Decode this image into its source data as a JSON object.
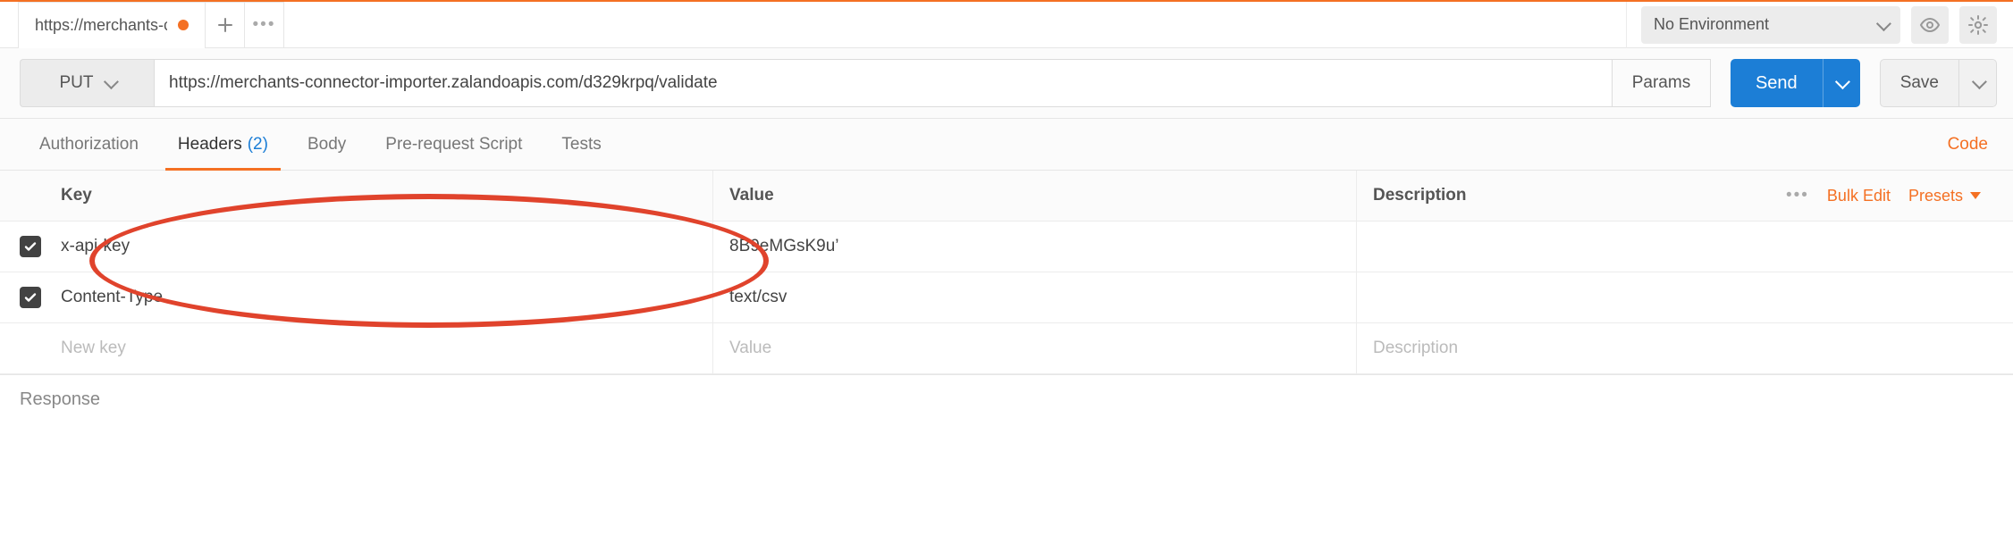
{
  "tab": {
    "label": "https://merchants-con"
  },
  "env": {
    "label": "No Environment"
  },
  "request": {
    "method": "PUT",
    "url": "https://merchants-connector-importer.zalandoapis.com/d329krpq/validate",
    "params_label": "Params",
    "send_label": "Send",
    "save_label": "Save"
  },
  "subtabs": {
    "authorization": "Authorization",
    "headers": "Headers",
    "headers_count": "(2)",
    "body": "Body",
    "pre_request": "Pre-request Script",
    "tests": "Tests",
    "code": "Code"
  },
  "table": {
    "th_key": "Key",
    "th_value": "Value",
    "th_description": "Description",
    "bulk_edit": "Bulk Edit",
    "presets": "Presets",
    "rows": [
      {
        "key": "x-api-key",
        "value": "8B9eMGsK9u’",
        "description": ""
      },
      {
        "key": "Content-Type",
        "value": "text/csv",
        "description": ""
      }
    ],
    "placeholder_key": "New key",
    "placeholder_value": "Value",
    "placeholder_description": "Description"
  },
  "response": {
    "label": "Response"
  }
}
